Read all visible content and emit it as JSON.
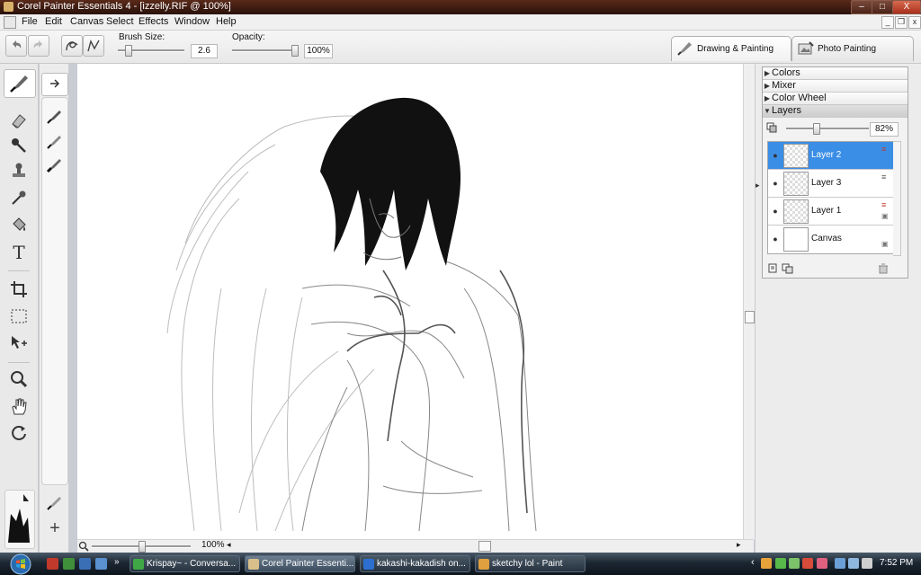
{
  "window": {
    "title": "Corel Painter Essentials 4 - [izzelly.RIF @ 100%]",
    "controls": {
      "minimize": "–",
      "maximize": "□",
      "close": "X"
    }
  },
  "menu": {
    "items": [
      "File",
      "Edit",
      "Canvas",
      "Select",
      "Effects",
      "Window",
      "Help"
    ],
    "doc_controls": {
      "minimize": "_",
      "restore": "❐",
      "close": "x"
    }
  },
  "propbar": {
    "undo_icon": "undo-icon",
    "redo_icon": "redo-icon",
    "brush_size_label": "Brush Size:",
    "brush_size_value": "2.6",
    "brush_size_level": 0.12,
    "opacity_label": "Opacity:",
    "opacity_value": "100%",
    "opacity_level": 1.0
  },
  "mode_tabs": [
    {
      "label": "Drawing & Painting",
      "active": true
    },
    {
      "label": "Photo Painting",
      "active": false
    }
  ],
  "toolbox": {
    "tools": [
      "brush-icon",
      "eraser-icon",
      "dropper-brush-icon",
      "stamp-icon",
      "pipette-icon",
      "paint-bucket-icon",
      "text-icon",
      "crop-icon",
      "rect-select-icon",
      "transform-icon",
      "magnifier-icon",
      "grabber-hand-icon",
      "rotate-page-icon"
    ],
    "text_tool_glyph": "T",
    "add_glyph": "+"
  },
  "canvas": {
    "zoom_value": "100%",
    "zoom_level": 0.5
  },
  "panels": {
    "headers": [
      "Colors",
      "Mixer",
      "Color Wheel",
      "Layers"
    ],
    "layers_opacity": "82%",
    "layers_opacity_level": 0.35,
    "layers": [
      {
        "name": "Layer 2",
        "selected": true
      },
      {
        "name": "Layer 3",
        "selected": false
      },
      {
        "name": "Layer 1",
        "selected": false
      },
      {
        "name": "Canvas",
        "selected": false
      }
    ]
  },
  "taskbar": {
    "tasks": [
      {
        "label": "Krispay~ - Conversa...",
        "icon_color": "#3fa845"
      },
      {
        "label": "Corel Painter Essenti...",
        "icon_color": "#d9c08a",
        "active": true
      },
      {
        "label": "kakashi-kakadish on...",
        "icon_color": "#2c6fd1"
      },
      {
        "label": "sketchy lol - Paint",
        "icon_color": "#e0a040"
      }
    ],
    "tray_chevron": "‹",
    "time": "7:52 PM"
  }
}
